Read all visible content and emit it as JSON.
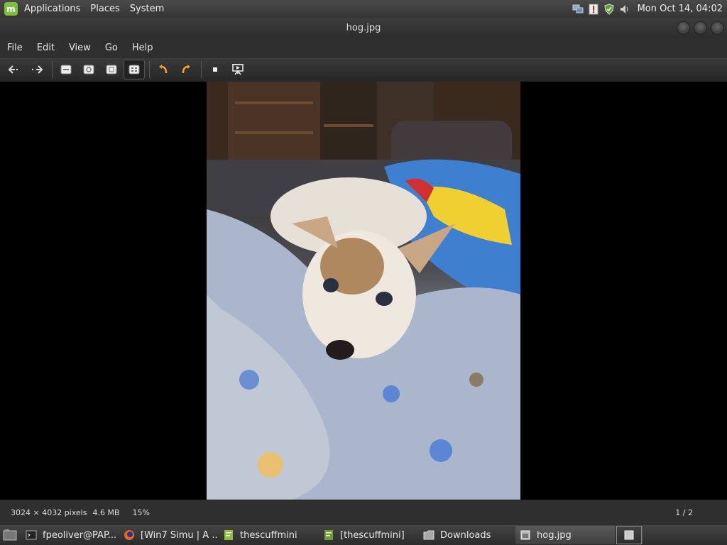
{
  "top_panel": {
    "menus": [
      "Applications",
      "Places",
      "System"
    ],
    "clock": "Mon Oct 14, 04:02"
  },
  "window": {
    "title": "hog.jpg"
  },
  "menubar": {
    "items": [
      "File",
      "Edit",
      "View",
      "Go",
      "Help"
    ]
  },
  "toolbar": {
    "icons": [
      "back-arrow-icon",
      "forward-arrow-icon",
      "zoom-in-icon",
      "zoom-normal-icon",
      "zoom-fit-icon",
      "zoom-fill-icon",
      "rotate-left-icon",
      "rotate-right-icon",
      "gallery-icon",
      "slideshow-icon"
    ]
  },
  "statusbar": {
    "dimensions": "3024 × 4032 pixels",
    "size": "4.6 MB",
    "zoom": "15%",
    "page": "1 / 2"
  },
  "taskbar": {
    "tasks": [
      {
        "label": "fpeoliver@PAP..."
      },
      {
        "label": "[Win7 Simu | A ..."
      },
      {
        "label": "thescuffmini"
      },
      {
        "label": "[thescuffmini]"
      },
      {
        "label": "Downloads"
      },
      {
        "label": "hog.jpg"
      }
    ]
  },
  "colors": {
    "accent_mint": "#7fbf3f",
    "rotate_orange": "#f0a020"
  }
}
